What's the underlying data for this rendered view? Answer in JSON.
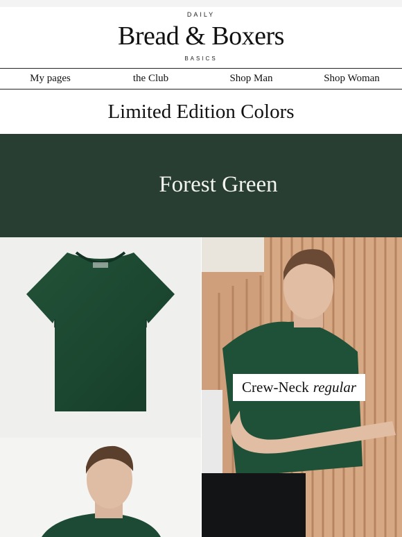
{
  "brand": {
    "top_line": "DAILY",
    "name": "Bread & Boxers",
    "bottom_line": "BASICS"
  },
  "nav": {
    "items": [
      {
        "label": "My pages"
      },
      {
        "label": "the Club"
      },
      {
        "label": "Shop Man"
      },
      {
        "label": "Shop Woman"
      }
    ]
  },
  "headline": "Limited Edition Colors",
  "banner": {
    "title": "Forest Green",
    "color": "#283e32"
  },
  "products": {
    "caption": {
      "name": "Crew-Neck",
      "fit": "regular"
    },
    "shirt_color": "#1f4a34"
  }
}
